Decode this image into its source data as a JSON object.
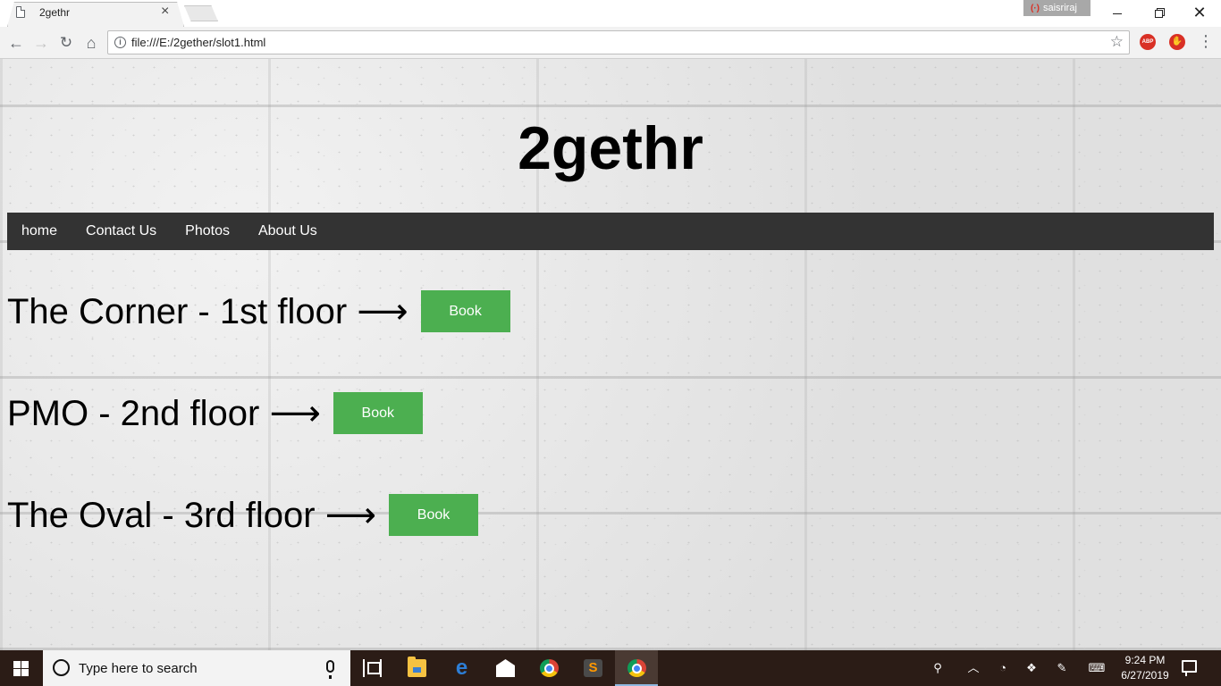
{
  "browser": {
    "tab_title": "2gethr",
    "tab_close": "×",
    "user_name": "saisriraj",
    "url": "file:///E:/2gether/slot1.html",
    "extensions": {
      "abp": "ABP"
    }
  },
  "page": {
    "title": "2gethr",
    "nav": [
      "home",
      "Contact Us",
      "Photos",
      "About Us"
    ],
    "rooms": [
      {
        "label": "The Corner - 1st floor ⟶",
        "button": "Book"
      },
      {
        "label": "PMO - 2nd floor ⟶",
        "button": "Book"
      },
      {
        "label": "The Oval - 3rd floor ⟶",
        "button": "Book"
      }
    ],
    "colors": {
      "nav_bg": "#333333",
      "button_bg": "#4caf50",
      "title": "#000000"
    }
  },
  "taskbar": {
    "search_placeholder": "Type here to search",
    "time": "9:24 PM",
    "date": "6/27/2019",
    "apps": [
      "task-view-icon",
      "file-explorer-icon",
      "edge-icon",
      "mail-icon",
      "chrome-icon",
      "sublime-text-icon",
      "chrome-active-icon"
    ]
  }
}
